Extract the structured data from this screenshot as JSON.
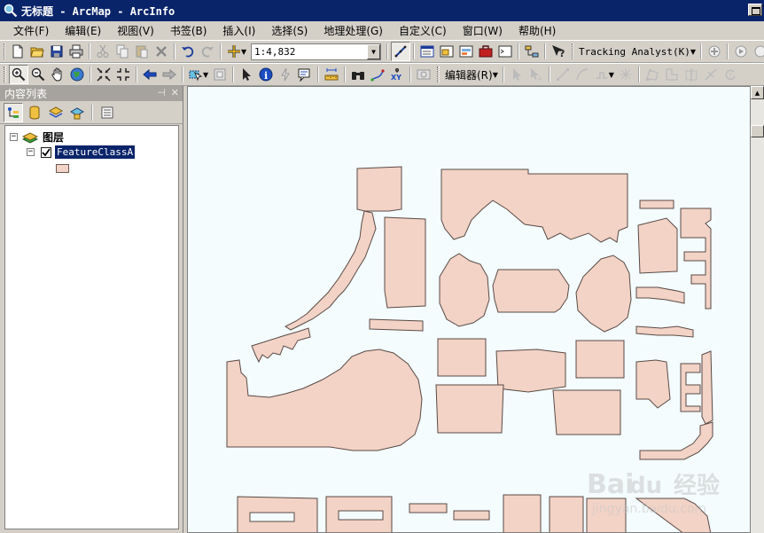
{
  "window": {
    "title": "无标题 - ArcMap - ArcInfo"
  },
  "menu": {
    "items": [
      "文件(F)",
      "编辑(E)",
      "视图(V)",
      "书签(B)",
      "插入(I)",
      "选择(S)",
      "地理处理(G)",
      "自定义(C)",
      "窗口(W)",
      "帮助(H)"
    ]
  },
  "toolbar": {
    "scale_value": "1:4,832",
    "tracking_label": "Tracking Analyst(K)",
    "editor_label": "编辑器(R)"
  },
  "toc": {
    "title": "内容列表",
    "group_label": "图层",
    "layer_name": "FeatureClassA",
    "layer_checked": true
  },
  "map": {
    "feature_fill": "#f2d3c6",
    "feature_stroke": "#5a4a46",
    "background": "#f4fcfd"
  },
  "watermark": {
    "brand": "Bai",
    "brand_tail": "经验",
    "url": "jingyan.baidu.com"
  },
  "colors": {
    "title_bar": "#0a246a",
    "chrome": "#d4d0c8",
    "toc_header": "#a6a39e"
  }
}
